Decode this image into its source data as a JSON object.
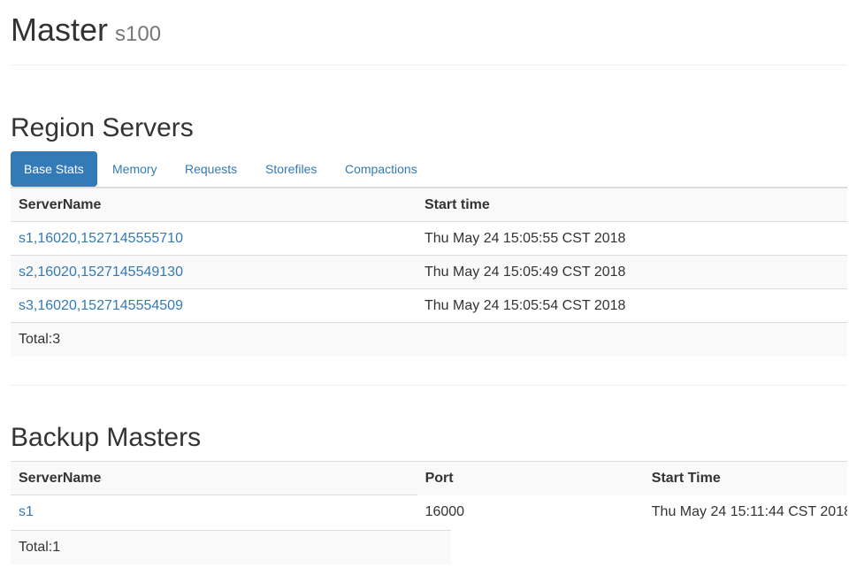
{
  "header": {
    "title": "Master",
    "subtitle": "s100"
  },
  "region_servers": {
    "title": "Region Servers",
    "tabs": [
      {
        "label": "Base Stats",
        "active": true
      },
      {
        "label": "Memory",
        "active": false
      },
      {
        "label": "Requests",
        "active": false
      },
      {
        "label": "Storefiles",
        "active": false
      },
      {
        "label": "Compactions",
        "active": false
      }
    ],
    "columns": [
      "ServerName",
      "Start time"
    ],
    "rows": [
      {
        "server": "s1,16020,1527145555710",
        "start": "Thu May 24 15:05:55 CST 2018"
      },
      {
        "server": "s2,16020,1527145549130",
        "start": "Thu May 24 15:05:49 CST 2018"
      },
      {
        "server": "s3,16020,1527145554509",
        "start": "Thu May 24 15:05:54 CST 2018"
      }
    ],
    "total": "Total:3"
  },
  "backup_masters": {
    "title": "Backup Masters",
    "columns": [
      "ServerName",
      "Port",
      "Start Time"
    ],
    "rows": [
      {
        "server": "s1",
        "port": "16000",
        "start": "Thu May 24 15:11:44 CST 2018"
      }
    ],
    "total": "Total:1"
  },
  "colors": {
    "link": "#337ab7",
    "active_tab_bg": "#337ab7",
    "row_shade": "#f9f9f9",
    "border": "#dddddd"
  }
}
